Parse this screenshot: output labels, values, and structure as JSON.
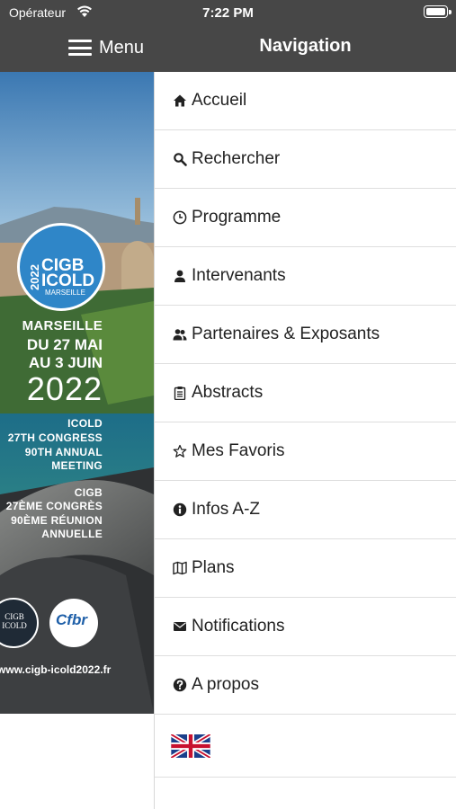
{
  "status_bar": {
    "carrier": "Opérateur",
    "time": "7:22 PM"
  },
  "header": {
    "menu_label": "Menu",
    "nav_title": "Navigation"
  },
  "poster": {
    "badge_year": "2022",
    "badge_line1": "CIGB",
    "badge_line2": "ICOLD",
    "badge_city": "MARSEILLE",
    "city": "MARSEILLE",
    "dates_line1": "DU 27 MAI",
    "dates_line2": "AU 3 JUIN",
    "year": "2022",
    "en_line1": "ICOLD",
    "en_line2": "27TH CONGRESS",
    "en_line3": "90TH ANNUAL",
    "en_line4": "MEETING",
    "fr_line1": "CIGB",
    "fr_line2": "27ÈME CONGRÈS",
    "fr_line3": "90ÈME RÉUNION",
    "fr_line4": "ANNUELLE",
    "logo1": "CIGB ICOLD",
    "logo2": "Cfbr",
    "website": "www.cigb-icold2022.fr"
  },
  "nav": {
    "items": [
      {
        "label": "Accueil",
        "icon": "home-icon"
      },
      {
        "label": "Rechercher",
        "icon": "search-icon"
      },
      {
        "label": "Programme",
        "icon": "clock-icon"
      },
      {
        "label": "Intervenants",
        "icon": "person-icon"
      },
      {
        "label": "Partenaires & Exposants",
        "icon": "people-icon"
      },
      {
        "label": "Abstracts",
        "icon": "clipboard-icon"
      },
      {
        "label": "Mes Favoris",
        "icon": "star-icon"
      },
      {
        "label": "Infos A-Z",
        "icon": "info-icon"
      },
      {
        "label": "Plans",
        "icon": "map-icon"
      },
      {
        "label": "Notifications",
        "icon": "envelope-icon"
      },
      {
        "label": "A propos",
        "icon": "question-icon"
      }
    ],
    "language_flag": "uk-flag-icon"
  },
  "colors": {
    "header_bg": "#474747",
    "drawer_bg": "#ffffff",
    "divider": "#dedede",
    "badge_blue": "#2f86c8"
  }
}
